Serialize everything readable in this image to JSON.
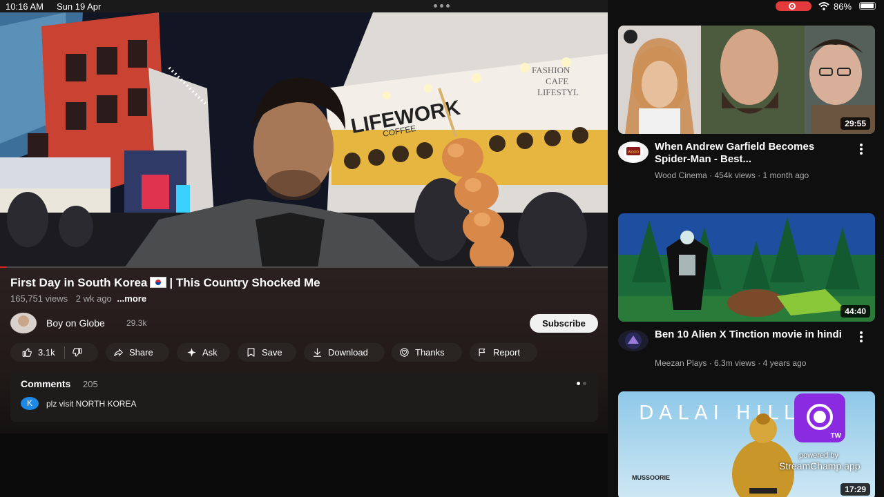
{
  "status_bar": {
    "time": "10:16 AM",
    "date": "Sun 19 Apr",
    "battery_percent": "86%",
    "battery_level": 0.86
  },
  "video": {
    "title": "First Day in South Korea",
    "title_suffix": "| This Country Shocked Me",
    "views": "165,751 views",
    "age": "2 wk ago",
    "more_label": "...more",
    "sign_text": "LIFEWORK",
    "sign_sub": "COFFEE",
    "cafe_text_1": "FASHION",
    "cafe_text_2": "CAFE",
    "cafe_text_3": "LIFESTYL"
  },
  "channel": {
    "name": "Boy on Globe",
    "subscribers": "29.3k",
    "subscribe_label": "Subscribe"
  },
  "actions": {
    "likes": "3.1k",
    "share": "Share",
    "ask": "Ask",
    "save": "Save",
    "download": "Download",
    "thanks": "Thanks",
    "report": "Report"
  },
  "comments": {
    "heading": "Comments",
    "count": "205",
    "top_comment_avatar": "K",
    "top_comment_text": "plz visit NORTH KOREA"
  },
  "recommendations": [
    {
      "title": "When Andrew Garfield Becomes Spider-Man - Best...",
      "meta": "Wood Cinema · 454k views · 1 month ago",
      "duration": "29:55",
      "avatar_text": "WOOD"
    },
    {
      "title": "Ben 10 Alien X Tinction movie in hindi",
      "meta": "Meezan Plays · 6.3m views · 4 years ago",
      "duration": "44:40",
      "avatar_text": ""
    },
    {
      "title_overlay": "DALAI HILLS",
      "brand_text": "MUSSOORIE",
      "duration": "17:29"
    }
  ],
  "overlay": {
    "tw_label": "TW",
    "powered_by": "powered by",
    "app_name": "StreamChamp.app"
  },
  "colors": {
    "accent_red": "#e02020",
    "chip_bg": "#2a2423",
    "overlay_purple": "#8a2be2"
  }
}
